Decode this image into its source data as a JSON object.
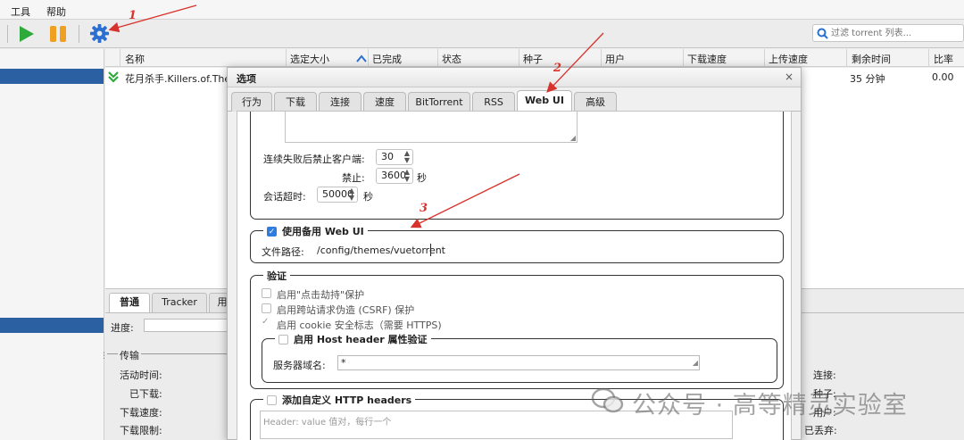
{
  "menu": [
    "工具",
    "帮助"
  ],
  "filter_placeholder": "过滤 torrent 列表...",
  "columns": [
    "名称",
    "选定大小",
    "已完成",
    "状态",
    "种子",
    "用户",
    "下载速度",
    "上传速度",
    "剩余时间",
    "比率"
  ],
  "row": {
    "name": "花月杀手.Killers.of.The.",
    "eta": "35 分钟",
    "ratio": "0.00"
  },
  "bottom_tabs": [
    "普通",
    "Tracker",
    "用"
  ],
  "bottom": {
    "progress": "进度:",
    "transfer": "传输",
    "active_time": "活动时间:",
    "downloaded": "已下载:",
    "dl_speed": "下载速度:",
    "dl_limit": "下载限制:",
    "connections": "连接:",
    "seeds": "种子:",
    "peers": "用户:",
    "wasted": "已丢弃:"
  },
  "dialog": {
    "title": "选项",
    "close": "×",
    "tabs": [
      "行为",
      "下载",
      "连接",
      "速度",
      "BitTorrent",
      "RSS",
      "Web UI",
      "高级"
    ],
    "active_tab": "Web UI",
    "ban_after": "连续失败后禁止客户端:",
    "ban_after_value": "30",
    "ban_for": "禁止:",
    "ban_for_value": "3600",
    "seconds": "秒",
    "session_timeout": "会话超时:",
    "session_timeout_value": "50000",
    "alt_webui": "使用备用 Web UI",
    "file_path_label": "文件路径:",
    "file_path_value": "/config/themes/vuetorrent",
    "auth_legend": "验证",
    "clickjacking": "启用\"点击劫持\"保护",
    "csrf": "启用跨站请求伪造 (CSRF) 保护",
    "cookie": "启用 cookie 安全标志（需要 HTTPS)",
    "host_header": "启用 Host header 属性验证",
    "server_domains": "服务器域名:",
    "server_domains_value": "*",
    "custom_headers": "添加自定义 HTTP headers",
    "headers_placeholder": "Header: value 值对，每行一个"
  },
  "annotations": [
    "1",
    "2",
    "3"
  ],
  "watermark": "公众号 · 高等精灵实验室",
  "colors": {
    "accent": "#2e7ce0",
    "arrow": "#d8322c",
    "play": "#2eaa3a",
    "pause": "#f0a020",
    "gear": "#2a6fd1"
  }
}
